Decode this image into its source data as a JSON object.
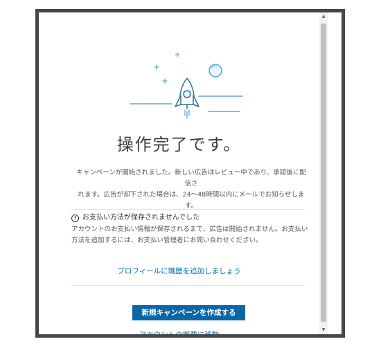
{
  "dialog": {
    "title": "操作完了です。",
    "description_line1": "キャンペーンが開始されました。新しい広告はレビュー中であり、承認後に配信さ",
    "description_line2": "れます。広告が却下された場合は、24～48時間以内にメールでお知らせしま",
    "description_line3": "す。",
    "notice": {
      "icon": "info-icon",
      "heading": "お支払い方法が保存されませんでした",
      "body_line1": "アカウントのお支払い情報が保存されるまで、広告は開始されません。お支払い",
      "body_line2": "方法を追加するには、お支払い管理者にお問い合わせください。"
    },
    "profile_link": "プロフィールに職歴を追加しましょう",
    "create_campaign_button": "新規キャンペーンを作成する",
    "account_overview_link": "アカウントの概要に移動"
  },
  "scrollbar": {
    "up_arrow": "▲",
    "down_arrow": "▼"
  },
  "colors": {
    "accent": "#0a66a6",
    "link": "#0073b1",
    "illustration": "#5aa9da",
    "frame": "#474747"
  }
}
